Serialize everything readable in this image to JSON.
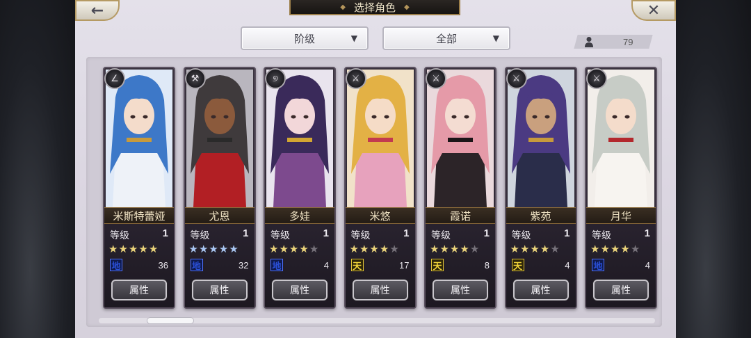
{
  "header": {
    "title": "选择角色",
    "back_icon": "←",
    "close_icon": "✕"
  },
  "filters": {
    "rank_label": "阶级",
    "scope_label": "全部",
    "arrow": "▼"
  },
  "owned_count": "79",
  "level_label": "等级",
  "attr_button_label": "属性",
  "colors": {
    "panel_bg": "#dcd7e2",
    "card_bg": "#2a2330",
    "name_bar": "#3a2e22",
    "star_gold": "#ead37a",
    "star_blue": "#a9c6f2",
    "earth_badge": "#2a4fd6",
    "heaven_badge": "#f2d43a"
  },
  "characters": [
    {
      "name": "米斯特蕾娅",
      "level": "1",
      "stars": 5,
      "star_style": "gold",
      "max_stars": 5,
      "element": "地",
      "element_type": "earth",
      "count": "36",
      "class_icon": "staff-icon",
      "class_glyph": "∠"
    },
    {
      "name": "尤恩",
      "level": "1",
      "stars": 5,
      "star_style": "blue",
      "max_stars": 5,
      "element": "地",
      "element_type": "earth",
      "count": "32",
      "class_icon": "hammer-icon",
      "class_glyph": "⚒"
    },
    {
      "name": "多娃",
      "level": "1",
      "stars": 4,
      "star_style": "gold",
      "max_stars": 5,
      "element": "地",
      "element_type": "earth",
      "count": "4",
      "class_icon": "scythe-icon",
      "class_glyph": "୭"
    },
    {
      "name": "米悠",
      "level": "1",
      "stars": 4,
      "star_style": "gold",
      "max_stars": 5,
      "element": "天",
      "element_type": "heaven",
      "count": "17",
      "class_icon": "sword-icon",
      "class_glyph": "⚔"
    },
    {
      "name": "霞诺",
      "level": "1",
      "stars": 4,
      "star_style": "gold",
      "max_stars": 5,
      "element": "天",
      "element_type": "heaven",
      "count": "8",
      "class_icon": "sword-icon",
      "class_glyph": "⚔"
    },
    {
      "name": "紫苑",
      "level": "1",
      "stars": 4,
      "star_style": "gold",
      "max_stars": 5,
      "element": "天",
      "element_type": "heaven",
      "count": "4",
      "class_icon": "blade-icon",
      "class_glyph": "⚔"
    },
    {
      "name": "月华",
      "level": "1",
      "stars": 4,
      "star_style": "gold",
      "max_stars": 5,
      "element": "地",
      "element_type": "earth",
      "count": "4",
      "class_icon": "blade-icon",
      "class_glyph": "⚔"
    }
  ]
}
